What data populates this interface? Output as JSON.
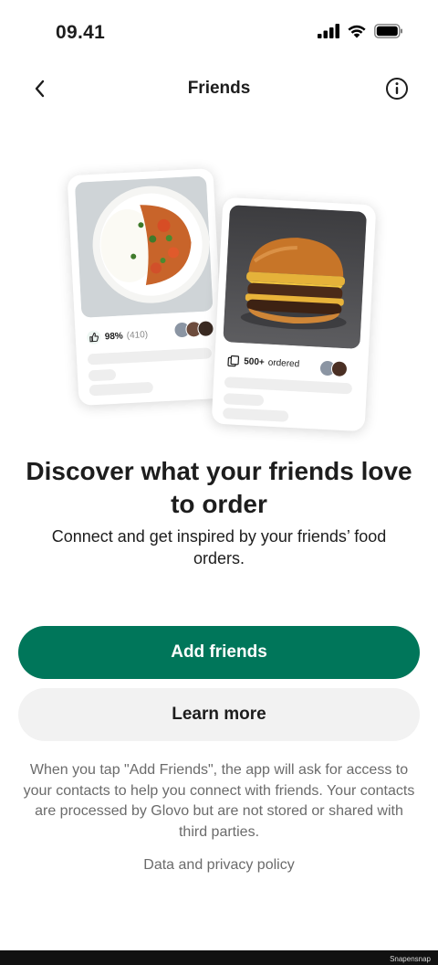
{
  "status_bar": {
    "time": "09.41"
  },
  "header": {
    "title": "Friends",
    "back_icon": "chevron-left-icon",
    "info_icon": "info-circle-icon"
  },
  "illustration": {
    "left_card": {
      "rating": "98%",
      "rating_count": "(410)",
      "icon": "thumbs-up-icon"
    },
    "right_card": {
      "ordered": "500+",
      "ordered_label": "ordered",
      "icon": "bag-icon"
    }
  },
  "main": {
    "headline": "Discover what your friends love to order",
    "subtext": "Connect and get inspired by your friends’ food orders."
  },
  "actions": {
    "primary_label": "Add friends",
    "secondary_label": "Learn more"
  },
  "footer": {
    "disclaimer": "When you tap \"Add Friends\", the app will ask for access to your contacts to help you connect with friends. Your contacts are processed by Glovo but are not stored or shared with third parties.",
    "privacy_link": "Data and privacy policy"
  },
  "watermark": "Snapensnap",
  "colors": {
    "primary": "#00765a",
    "secondary_bg": "#f2f2f2",
    "muted_text": "#6b6b6b"
  }
}
